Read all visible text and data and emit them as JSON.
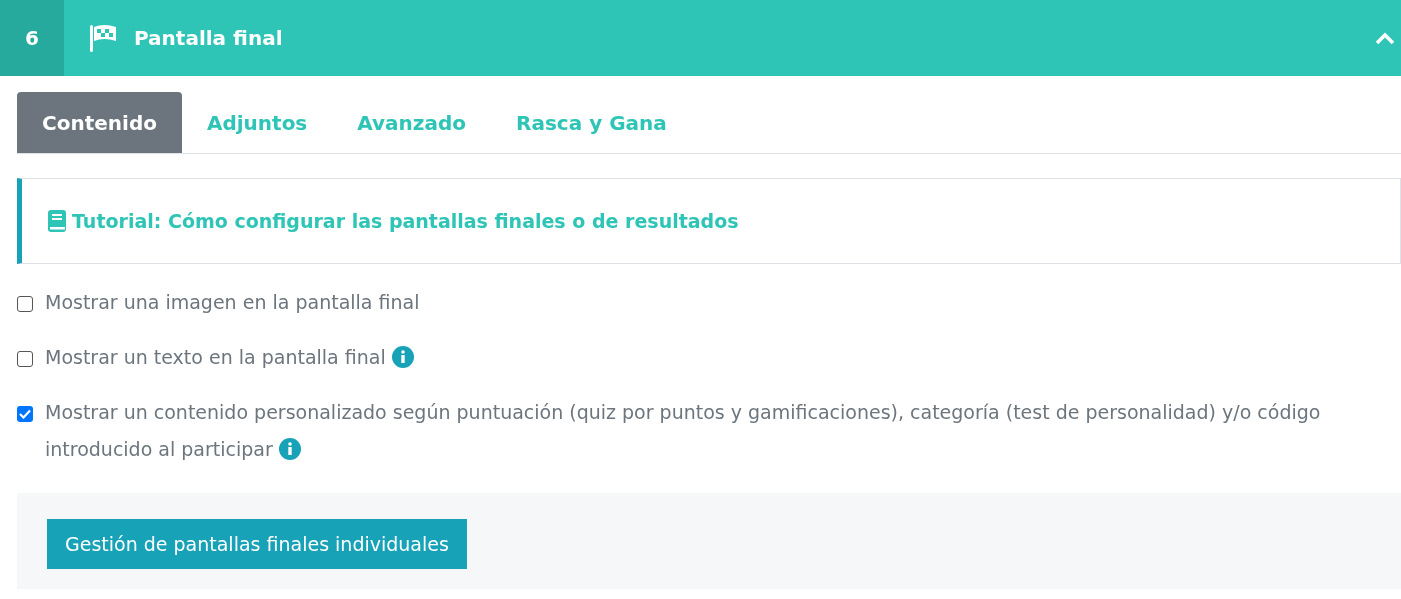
{
  "section": {
    "number": "6",
    "title": "Pantalla final",
    "expanded": true
  },
  "tabs": [
    {
      "label": "Contenido",
      "selected": true
    },
    {
      "label": "Adjuntos",
      "selected": false
    },
    {
      "label": "Avanzado",
      "selected": false
    },
    {
      "label": "Rasca y Gana",
      "selected": false
    }
  ],
  "tutorial_link": "Tutorial: Cómo configurar las pantallas finales o de resultados",
  "options": [
    {
      "label": "Mostrar una imagen en la pantalla final",
      "checked": false,
      "info": false
    },
    {
      "label": "Mostrar un texto en la pantalla final",
      "checked": false,
      "info": true
    },
    {
      "label": "Mostrar un contenido personalizado según puntuación (quiz por puntos y gamificaciones), categoría (test de personalidad) y/o código introducido al participar",
      "checked": true,
      "info": true
    }
  ],
  "manage_button": "Gestión de pantallas finales individuales"
}
